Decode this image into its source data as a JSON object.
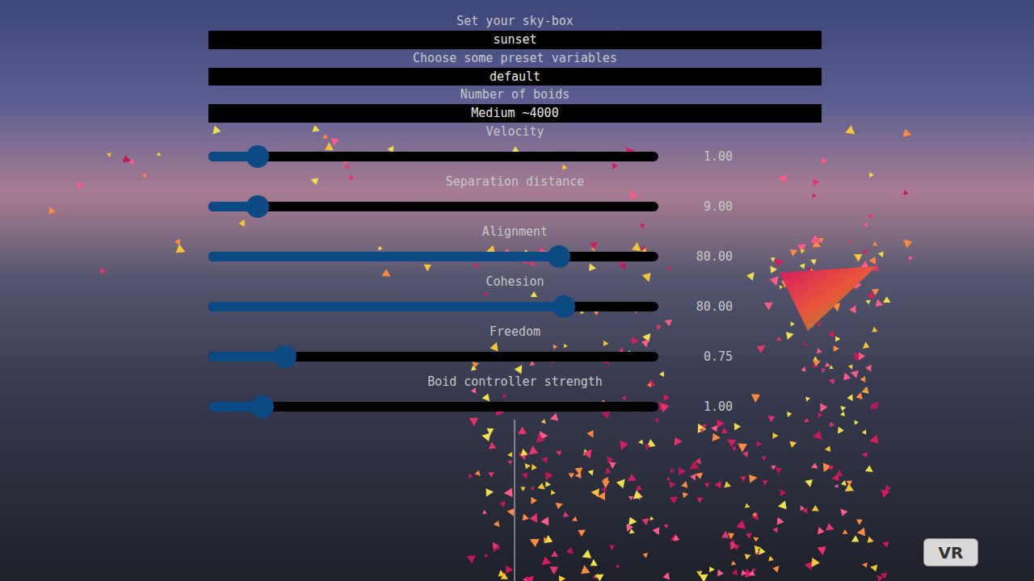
{
  "dropdowns": [
    {
      "label": "Set your sky-box",
      "value": "sunset"
    },
    {
      "label": "Choose some preset variables",
      "value": "default"
    },
    {
      "label": "Number of boids",
      "value": "Medium ~4000"
    }
  ],
  "sliders": [
    {
      "label": "Velocity",
      "level": 0.11,
      "reading": "1.00"
    },
    {
      "label": "Separation distance",
      "level": 0.11,
      "reading": "9.00"
    },
    {
      "label": "Alignment",
      "level": 0.78,
      "reading": "80.00"
    },
    {
      "label": "Cohesion",
      "level": 0.79,
      "reading": "80.00"
    },
    {
      "label": "Freedom",
      "level": 0.17,
      "reading": "0.75"
    },
    {
      "label": "Boid controller strength",
      "level": 0.12,
      "reading": "1.00"
    }
  ],
  "vr_button": "VR"
}
